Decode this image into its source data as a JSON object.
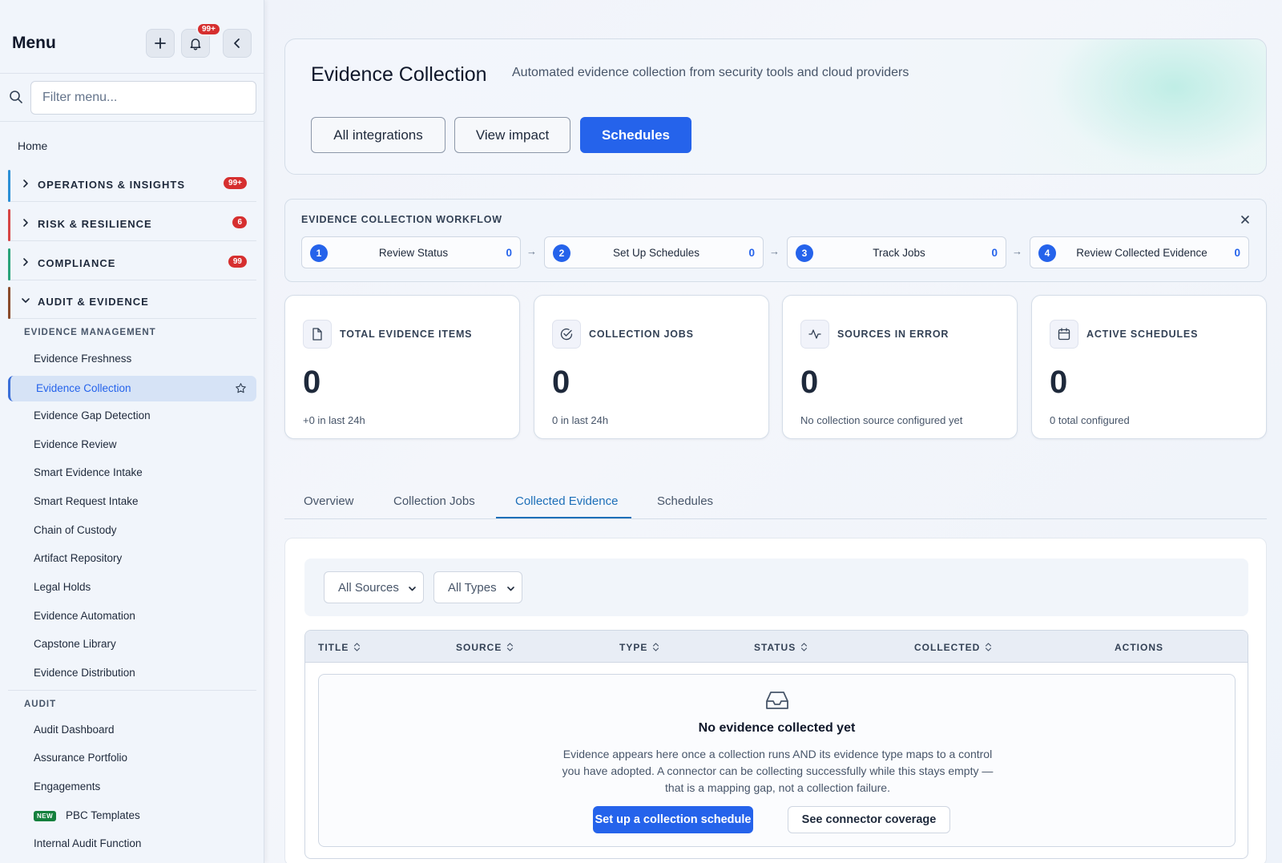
{
  "sidebar": {
    "title": "Menu",
    "notifications_badge": "99+",
    "filter_placeholder": "Filter menu...",
    "home": "Home",
    "sections": [
      {
        "label": "OPERATIONS & INSIGHTS",
        "badge": "99+",
        "color": "#2b8fd6"
      },
      {
        "label": "RISK & RESILIENCE",
        "badge": "6",
        "color": "#d64545"
      },
      {
        "label": "COMPLIANCE",
        "badge": "99",
        "color": "#2aa37a"
      },
      {
        "label": "AUDIT & EVIDENCE",
        "badge": "",
        "color": "#8a4b2b"
      }
    ],
    "evidence_management": {
      "heading": "EVIDENCE MANAGEMENT",
      "items": [
        "Evidence Freshness",
        "Evidence Collection",
        "Evidence Gap Detection",
        "Evidence Review",
        "Smart Evidence Intake",
        "Smart Request Intake",
        "Chain of Custody",
        "Artifact Repository",
        "Legal Holds",
        "Evidence Automation",
        "Capstone Library",
        "Evidence Distribution"
      ]
    },
    "audit": {
      "heading": "AUDIT",
      "items": [
        "Audit Dashboard",
        "Assurance Portfolio",
        "Engagements",
        "PBC Templates",
        "Internal Audit Function"
      ],
      "new_badge": "NEW"
    }
  },
  "hero": {
    "title": "Evidence Collection",
    "subtitle": "Automated evidence collection from security tools and cloud providers",
    "buttons": {
      "integrations": "All integrations",
      "impact": "View impact",
      "schedules": "Schedules"
    }
  },
  "workflow": {
    "title": "EVIDENCE COLLECTION WORKFLOW",
    "steps": [
      {
        "num": "1",
        "label": "Review Status",
        "count": "0"
      },
      {
        "num": "2",
        "label": "Set Up Schedules",
        "count": "0"
      },
      {
        "num": "3",
        "label": "Track Jobs",
        "count": "0"
      },
      {
        "num": "4",
        "label": "Review Collected Evidence",
        "count": "0"
      }
    ],
    "arrow": "→"
  },
  "kpis": [
    {
      "label": "TOTAL EVIDENCE ITEMS",
      "value": "0",
      "note": "+0 in last 24h",
      "icon": "document-icon"
    },
    {
      "label": "COLLECTION JOBS",
      "value": "0",
      "note": "0 in last 24h",
      "icon": "check-circle-icon"
    },
    {
      "label": "SOURCES IN ERROR",
      "value": "0",
      "note": "No collection source configured yet",
      "icon": "activity-icon"
    },
    {
      "label": "ACTIVE SCHEDULES",
      "value": "0",
      "note": "0 total configured",
      "icon": "calendar-icon"
    }
  ],
  "tabs": [
    "Overview",
    "Collection Jobs",
    "Collected Evidence",
    "Schedules"
  ],
  "active_tab": "Collected Evidence",
  "filters": {
    "sources": "All Sources",
    "types": "All Types"
  },
  "table": {
    "columns": [
      "TITLE",
      "SOURCE",
      "TYPE",
      "STATUS",
      "COLLECTED",
      "ACTIONS"
    ]
  },
  "empty_state": {
    "heading": "No evidence collected yet",
    "body": "Evidence appears here once a collection runs AND its evidence type maps to a control you have adopted. A connector can be collecting successfully while this stays empty — that is a mapping gap, not a collection failure.",
    "primary_button": "Set up a collection schedule",
    "secondary_button": "See connector coverage"
  }
}
